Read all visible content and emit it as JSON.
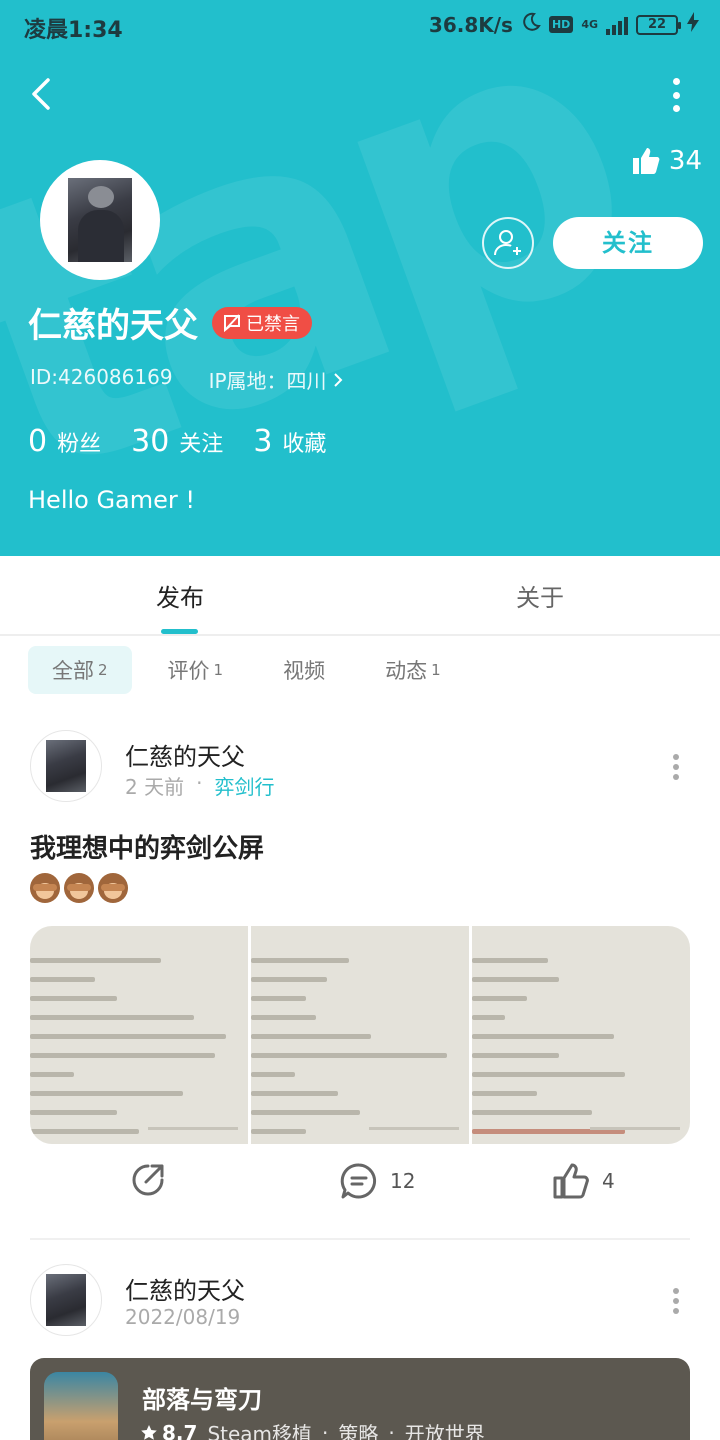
{
  "status_bar": {
    "time": "凌晨1:34",
    "speed": "36.8K/s",
    "hd": "HD",
    "network": "4G",
    "battery": "22"
  },
  "header": {
    "likes": "34",
    "follow_label": "关注",
    "username": "仁慈的天父",
    "ban_badge": "已禁言",
    "id_text": "ID:426086169",
    "ip_text": "IP属地：四川",
    "stats": [
      {
        "num": "0",
        "label": "粉丝"
      },
      {
        "num": "30",
        "label": "关注"
      },
      {
        "num": "3",
        "label": "收藏"
      }
    ],
    "bio": "Hello Gamer !",
    "accent": "#22bfcc"
  },
  "tabs": [
    {
      "label": "发布"
    },
    {
      "label": "关于"
    }
  ],
  "filters": [
    {
      "label": "全部",
      "count": "2"
    },
    {
      "label": "评价",
      "count": "1"
    },
    {
      "label": "视频",
      "count": ""
    },
    {
      "label": "动态",
      "count": "1"
    }
  ],
  "posts": [
    {
      "author": "仁慈的天父",
      "time": "2 天前",
      "separator": "·",
      "game": "弈剑行",
      "title": "我理想中的弈剑公屏",
      "actions": {
        "comments": "12",
        "likes": "4"
      }
    },
    {
      "author": "仁慈的天父",
      "time": "2022/08/19",
      "game_card": {
        "title": "部落与弯刀",
        "score": "8.7",
        "tags": [
          "Steam移植",
          "策略",
          "开放世界"
        ],
        "separator": "·"
      }
    }
  ]
}
